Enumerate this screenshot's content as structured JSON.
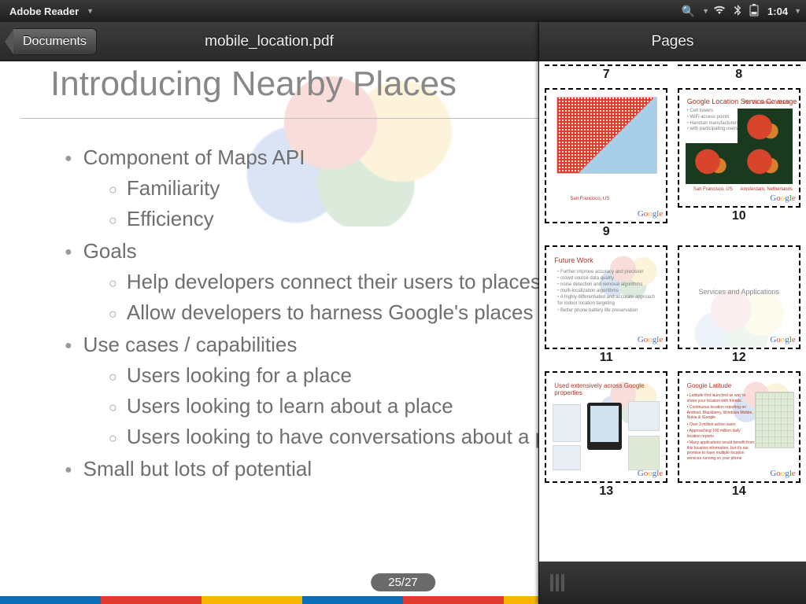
{
  "status": {
    "app_name": "Adobe Reader",
    "time": "1:04"
  },
  "header": {
    "back_label": "Documents",
    "doc_title": "mobile_location.pdf",
    "pages_title": "Pages"
  },
  "slide": {
    "title": "Introducing Nearby Places",
    "bullets": [
      {
        "text": "Component of Maps API",
        "sub": [
          "Familiarity",
          "Efficiency"
        ]
      },
      {
        "text": "Goals",
        "sub": [
          "Help developers connect their users to places",
          "Allow developers to harness Google's places DB"
        ]
      },
      {
        "text": "Use cases / capabilities",
        "sub": [
          "Users looking for a place",
          "Users looking to learn about a place",
          "Users looking to have conversations about a place"
        ]
      },
      {
        "text": "Small but lots of potential",
        "sub": []
      }
    ],
    "counter": "25/27"
  },
  "color_strip": [
    "#0b6db7",
    "#e03b2e",
    "#f7b500",
    "#0b6db7",
    "#e03b2e",
    "#f7b500",
    "#0b6db7",
    "#e03b2e"
  ],
  "pages_panel": {
    "thumbs": [
      {
        "num": "7"
      },
      {
        "num": "8"
      },
      {
        "num": "9",
        "title": "",
        "city_a": "San Francisco, US"
      },
      {
        "num": "10",
        "title": "Google Location Service Coverage",
        "list": [
          "Cell towers",
          "WiFi access points",
          "Handset manufacturers",
          "with participating users"
        ],
        "lab_a": "Rio De Janeiro, Brazil",
        "lab_b": "San Francisco, US",
        "lab_c": "Amsterdam, Netherlands"
      },
      {
        "num": "11",
        "title": "Future Work",
        "list": [
          "Further improve accuracy and precision",
          "crowd source data quality",
          "noise detection and removal algorithms",
          "multi-localization algorithms",
          "A highly differentiated and accurate approach for indoor location targeting",
          "Better phone battery life preservation"
        ]
      },
      {
        "num": "12",
        "title": "Services and Applications"
      },
      {
        "num": "13",
        "title": "Used extensively across Google properties"
      },
      {
        "num": "14",
        "title": "Google Latitude",
        "list": [
          "Latitude first launched as way to share your location with friends",
          "Continuous location reporting on Android, Blackberry, Windows Mobile, Nokia & iGoogle",
          "Over 3 million active users",
          "Approaching 100 million daily location reports",
          "Many applications would benefit from this location information, but it's our promise to have multiple location services running on your phone"
        ]
      }
    ]
  }
}
